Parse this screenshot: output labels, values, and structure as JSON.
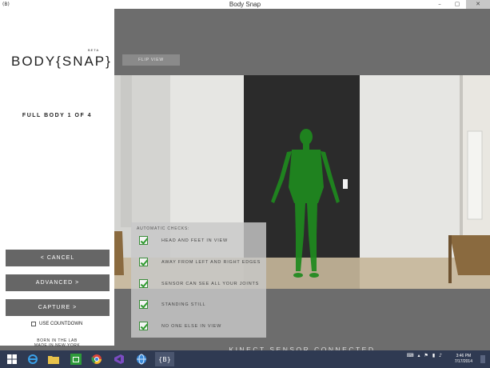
{
  "window": {
    "title": "Body Snap",
    "app_icon": "(B)",
    "minimize_icon": "–",
    "maximize_icon": "▢",
    "close_icon": "✕"
  },
  "sidebar": {
    "logo": "BODY{SNAP}",
    "logo_beta": "BETA",
    "counter": "FULL BODY 1 OF 4",
    "cancel_label": "< CANCEL",
    "advanced_label": "ADVANCED >",
    "capture_label": "CAPTURE >",
    "countdown_label": "USE COUNTDOWN",
    "countdown_checked": false,
    "footer_line1": "BORN IN THE LAB",
    "footer_line2": "MADE IN NEW YORK"
  },
  "main": {
    "flip_view_label": "FLIP VIEW",
    "checks_header": "AUTOMATIC CHECKS:",
    "checks": [
      {
        "label": "HEAD AND FEET IN VIEW",
        "checked": true
      },
      {
        "label": "AWAY FROM LEFT AND RIGHT EDGES",
        "checked": true
      },
      {
        "label": "SENSOR CAN SEE ALL YOUR JOINTS",
        "checked": true
      },
      {
        "label": "STANDING STILL",
        "checked": true
      },
      {
        "label": "NO ONE ELSE IN VIEW",
        "checked": true
      }
    ],
    "status_text": "KINECT SENSOR CONNECTED"
  },
  "taskbar": {
    "apps": [
      "start-icon",
      "ie-icon",
      "folder-icon",
      "store-icon",
      "chrome-icon",
      "visual-studio-icon",
      "browser-icon",
      "bodysnap-icon"
    ],
    "bodysnap_label": "{B}",
    "time": "3:46 PM",
    "date": "7/17/2014"
  },
  "colors": {
    "sidebar_bg": "#ffffff",
    "button_bg": "#666666",
    "main_bg": "#6d6d6d",
    "check_green": "#2e9a2e",
    "overlay_green": "#1e8a1e",
    "taskbar_bg": "#2f3a52"
  }
}
